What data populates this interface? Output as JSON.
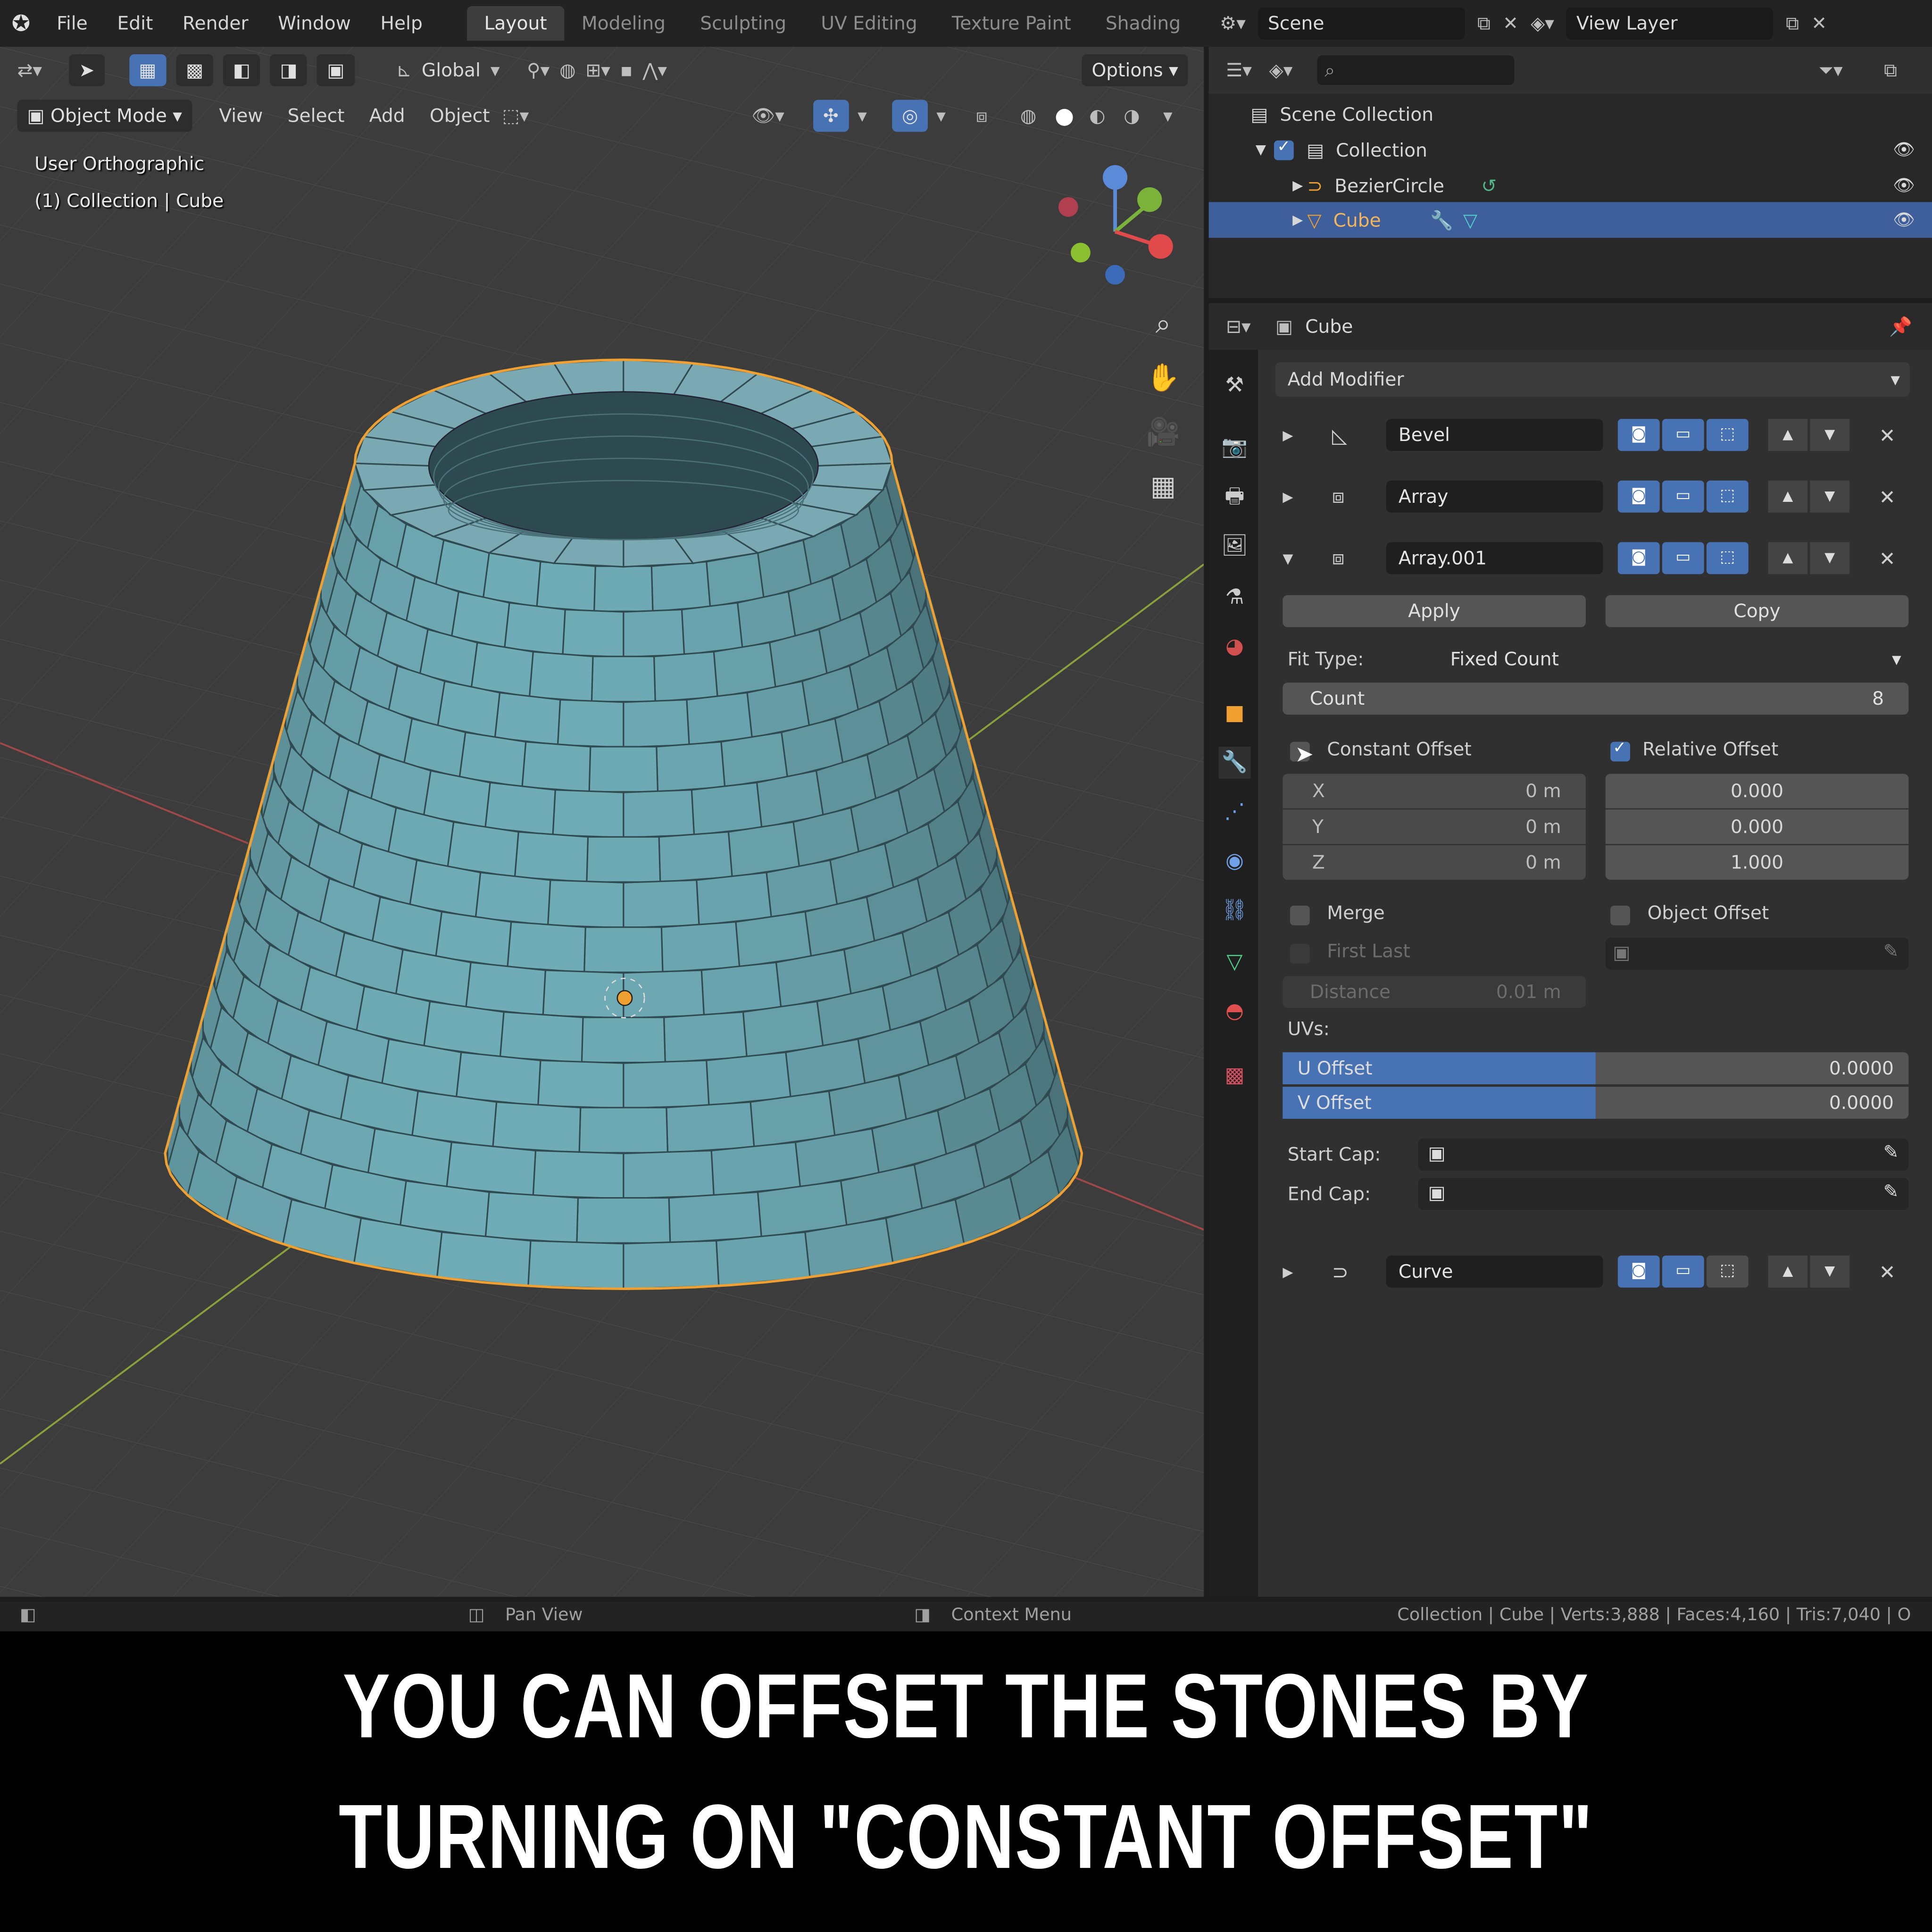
{
  "menubar": {
    "menus": [
      "File",
      "Edit",
      "Render",
      "Window",
      "Help"
    ],
    "workspaces": [
      "Layout",
      "Modeling",
      "Sculpting",
      "UV Editing",
      "Texture Paint",
      "Shading"
    ],
    "active_workspace": "Layout",
    "scene": "Scene",
    "view_layer": "View Layer"
  },
  "viewport": {
    "transform_orientation": "Global",
    "options_label": "Options",
    "mode": "Object Mode",
    "menus": [
      "View",
      "Select",
      "Add",
      "Object"
    ],
    "view_name": "User Orthographic",
    "context": "(1) Collection | Cube"
  },
  "outliner": {
    "scene_collection": "Scene Collection",
    "collection": "Collection",
    "objects": [
      "BezierCircle",
      "Cube"
    ],
    "selected": "Cube"
  },
  "properties": {
    "object_name": "Cube",
    "add_modifier": "Add Modifier",
    "modifiers": [
      {
        "name": "Bevel",
        "expanded": false
      },
      {
        "name": "Array",
        "expanded": false
      },
      {
        "name": "Array.001",
        "expanded": true
      },
      {
        "name": "Curve",
        "expanded": false
      }
    ],
    "apply_label": "Apply",
    "copy_label": "Copy",
    "fit_type_label": "Fit Type:",
    "fit_type_value": "Fixed Count",
    "count_label": "Count",
    "count_value": "8",
    "constant_offset_label": "Constant Offset",
    "constant_offset_checked": false,
    "relative_offset_label": "Relative Offset",
    "relative_offset_checked": true,
    "constant": {
      "x_label": "X",
      "x": "0 m",
      "y_label": "Y",
      "y": "0 m",
      "z_label": "Z",
      "z": "0 m"
    },
    "relative": {
      "x": "0.000",
      "y": "0.000",
      "z": "1.000"
    },
    "merge_label": "Merge",
    "first_last_label": "First Last",
    "distance_label": "Distance",
    "distance_value": "0.01 m",
    "object_offset_label": "Object Offset",
    "uvs_label": "UVs:",
    "u_offset_label": "U Offset",
    "u_offset_value": "0.0000",
    "v_offset_label": "V Offset",
    "v_offset_value": "0.0000",
    "start_cap_label": "Start Cap:",
    "end_cap_label": "End Cap:"
  },
  "statusbar": {
    "pan": "Pan View",
    "context_menu": "Context Menu",
    "stats": "Collection | Cube | Verts:3,888 | Faces:4,160 | Tris:7,040 | O"
  },
  "caption": {
    "line1": "YOU CAN OFFSET THE STONES BY",
    "line2": "TURNING ON \"CONSTANT OFFSET\""
  },
  "colors": {
    "accent": "#4772b3",
    "mesh": "#7aa9b4",
    "selection_outline": "#f0a030"
  }
}
